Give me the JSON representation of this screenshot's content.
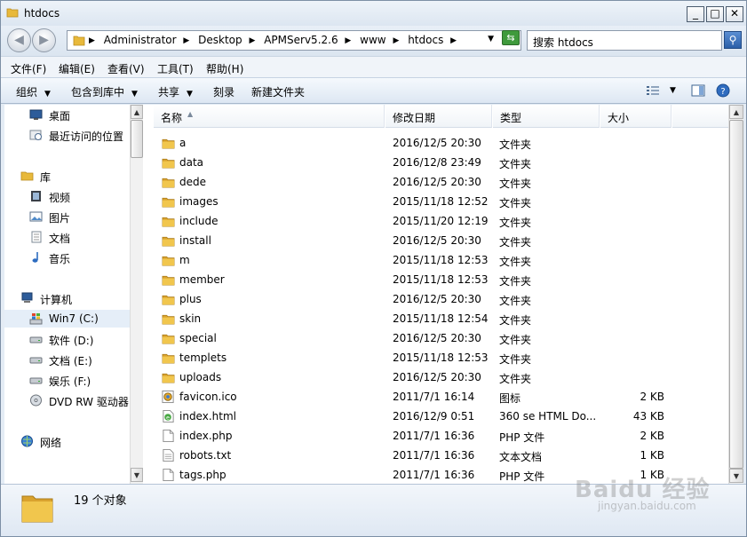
{
  "window": {
    "title": "htdocs",
    "controls": {
      "minimize": "_",
      "maximize": "□",
      "close": "✕"
    }
  },
  "address": {
    "crumbs": [
      "Administrator",
      "Desktop",
      "APMServ5.2.6",
      "www",
      "htdocs"
    ],
    "search_placeholder": "搜索 htdocs"
  },
  "menu": [
    "文件(F)",
    "编辑(E)",
    "查看(V)",
    "工具(T)",
    "帮助(H)"
  ],
  "toolbar": {
    "organize": "组织",
    "include_in_library": "包含到库中",
    "share": "共享",
    "burn": "刻录",
    "new_folder": "新建文件夹"
  },
  "nav": {
    "favorites": [
      {
        "label": "桌面",
        "icon": "desktop-icon"
      },
      {
        "label": "最近访问的位置",
        "icon": "recent-places-icon"
      }
    ],
    "libraries_label": "库",
    "libraries": [
      {
        "label": "视频",
        "icon": "video-icon"
      },
      {
        "label": "图片",
        "icon": "pictures-icon"
      },
      {
        "label": "文档",
        "icon": "documents-icon"
      },
      {
        "label": "音乐",
        "icon": "music-icon"
      }
    ],
    "computer_label": "计算机",
    "drives": [
      {
        "label": "Win7 (C:)",
        "icon": "windows-drive-icon",
        "selected": true
      },
      {
        "label": "软件 (D:)",
        "icon": "drive-icon"
      },
      {
        "label": "文档 (E:)",
        "icon": "drive-icon"
      },
      {
        "label": "娱乐 (F:)",
        "icon": "drive-icon"
      },
      {
        "label": "DVD RW 驱动器",
        "icon": "dvd-drive-icon"
      }
    ],
    "network_label": "网络"
  },
  "columns": {
    "name": "名称",
    "date": "修改日期",
    "type": "类型",
    "size": "大小"
  },
  "files": [
    {
      "name": "a",
      "date": "2016/12/5 20:30",
      "type": "文件夹",
      "size": "",
      "icon": "folder-icon"
    },
    {
      "name": "data",
      "date": "2016/12/8 23:49",
      "type": "文件夹",
      "size": "",
      "icon": "folder-icon"
    },
    {
      "name": "dede",
      "date": "2016/12/5 20:30",
      "type": "文件夹",
      "size": "",
      "icon": "folder-icon"
    },
    {
      "name": "images",
      "date": "2015/11/18 12:52",
      "type": "文件夹",
      "size": "",
      "icon": "folder-icon"
    },
    {
      "name": "include",
      "date": "2015/11/20 12:19",
      "type": "文件夹",
      "size": "",
      "icon": "folder-icon"
    },
    {
      "name": "install",
      "date": "2016/12/5 20:30",
      "type": "文件夹",
      "size": "",
      "icon": "folder-icon"
    },
    {
      "name": "m",
      "date": "2015/11/18 12:53",
      "type": "文件夹",
      "size": "",
      "icon": "folder-icon"
    },
    {
      "name": "member",
      "date": "2015/11/18 12:53",
      "type": "文件夹",
      "size": "",
      "icon": "folder-icon"
    },
    {
      "name": "plus",
      "date": "2016/12/5 20:30",
      "type": "文件夹",
      "size": "",
      "icon": "folder-icon"
    },
    {
      "name": "skin",
      "date": "2015/11/18 12:54",
      "type": "文件夹",
      "size": "",
      "icon": "folder-icon"
    },
    {
      "name": "special",
      "date": "2016/12/5 20:30",
      "type": "文件夹",
      "size": "",
      "icon": "folder-icon"
    },
    {
      "name": "templets",
      "date": "2015/11/18 12:53",
      "type": "文件夹",
      "size": "",
      "icon": "folder-icon"
    },
    {
      "name": "uploads",
      "date": "2016/12/5 20:30",
      "type": "文件夹",
      "size": "",
      "icon": "folder-icon"
    },
    {
      "name": "favicon.ico",
      "date": "2011/7/1 16:14",
      "type": "图标",
      "size": "2 KB",
      "icon": "ico-file-icon"
    },
    {
      "name": "index.html",
      "date": "2016/12/9 0:51",
      "type": "360 se HTML Do...",
      "size": "43 KB",
      "icon": "html-file-icon"
    },
    {
      "name": "index.php",
      "date": "2011/7/1 16:36",
      "type": "PHP 文件",
      "size": "2 KB",
      "icon": "document-icon"
    },
    {
      "name": "robots.txt",
      "date": "2011/7/1 16:36",
      "type": "文本文档",
      "size": "1 KB",
      "icon": "text-file-icon"
    },
    {
      "name": "tags.php",
      "date": "2011/7/1 16:36",
      "type": "PHP 文件",
      "size": "1 KB",
      "icon": "document-icon"
    }
  ],
  "status": {
    "count": "19 个对象"
  },
  "watermark": {
    "brand": "Baidu 经验",
    "url": "jingyan.baidu.com"
  },
  "colors": {
    "folder": "#e8b93b",
    "selection": "#e5eef8",
    "accent": "#2b5fa8"
  }
}
